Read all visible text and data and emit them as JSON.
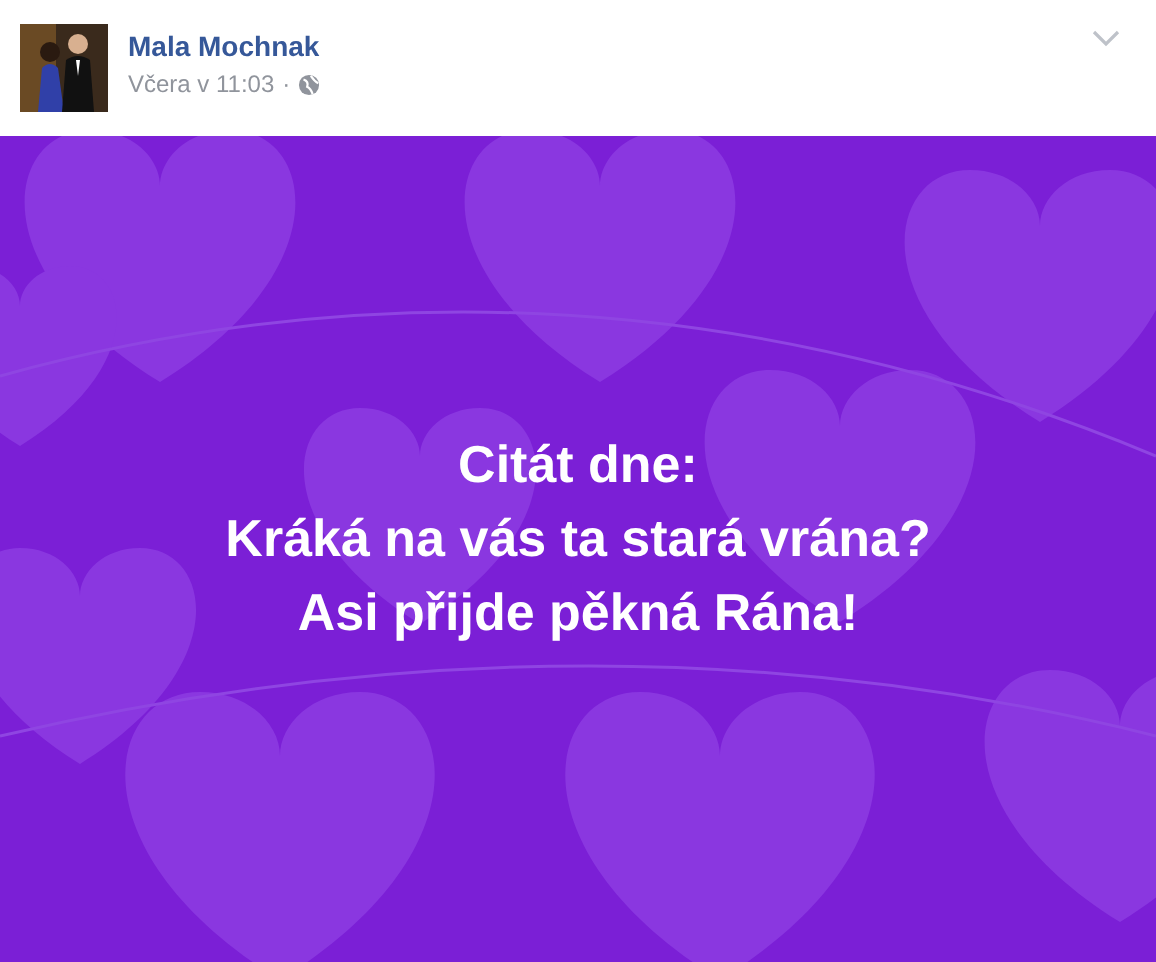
{
  "post": {
    "author": "Mala Mochnak",
    "time": "Včera v 11:03",
    "separator": "·",
    "quote_lines": [
      "Citát dne:",
      "Kráká na vás ta stará vrána?",
      "Asi přijde pěkná Rána!"
    ]
  }
}
